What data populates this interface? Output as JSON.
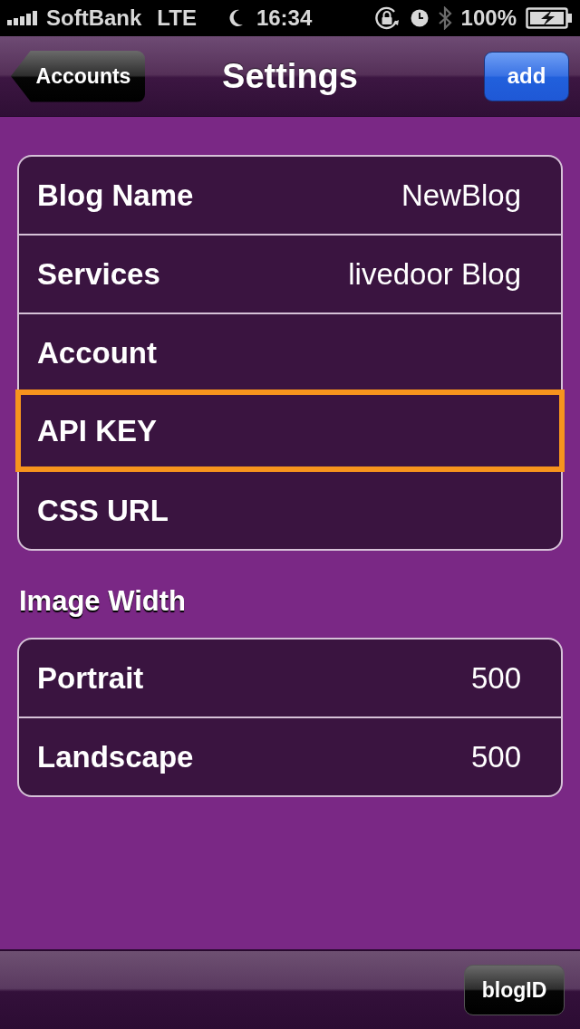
{
  "status_bar": {
    "carrier": "SoftBank",
    "network": "LTE",
    "time": "16:34",
    "battery": "100%"
  },
  "nav_bar": {
    "back_button": "Accounts",
    "title": "Settings",
    "action_button": "add"
  },
  "sections": [
    {
      "rows": [
        {
          "label": "Blog Name",
          "value": "NewBlog",
          "highlighted": false
        },
        {
          "label": "Services",
          "value": "livedoor Blog",
          "highlighted": false
        },
        {
          "label": "Account",
          "highlighted": false
        },
        {
          "label": "API KEY",
          "highlighted": true
        },
        {
          "label": "CSS URL",
          "highlighted": false
        }
      ]
    },
    {
      "header": "Image Width",
      "rows": [
        {
          "label": "Portrait",
          "value": "500",
          "highlighted": false
        },
        {
          "label": "Landscape",
          "value": "500",
          "highlighted": false
        }
      ]
    }
  ],
  "toolbar": {
    "button": "blogID"
  }
}
